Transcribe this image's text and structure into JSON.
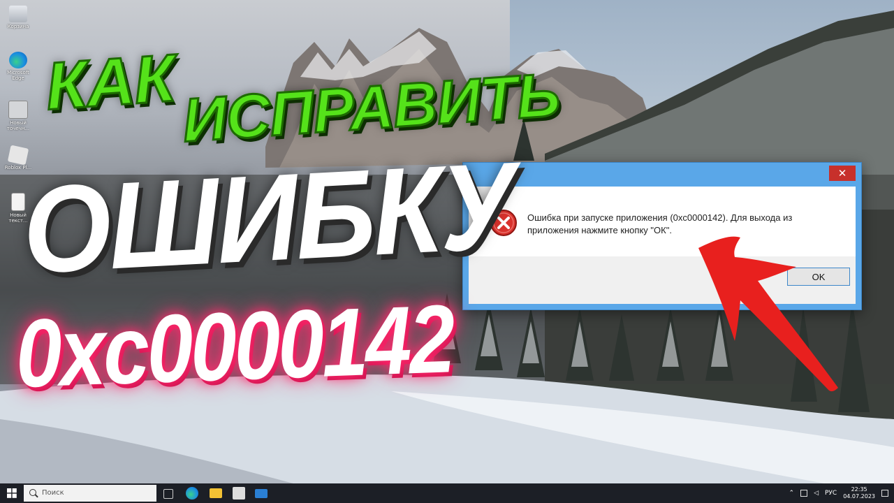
{
  "overlay": {
    "line1_a": "КАК",
    "line1_b": "ИСПРАВИТЬ",
    "line2": "ОШИБКУ",
    "line3": "0xc0000142"
  },
  "desktop_icons": [
    {
      "label": "Корзина",
      "icon": "recycle-bin-icon"
    },
    {
      "label": "Microsoft Edge",
      "icon": "edge-icon"
    },
    {
      "label": "Новый точечн...",
      "icon": "image-file-icon"
    },
    {
      "label": "Roblox Pl...",
      "icon": "roblox-icon"
    },
    {
      "label": "Новый текст...",
      "icon": "text-file-icon"
    }
  ],
  "dialog": {
    "close_label": "✕",
    "message": "Ошибка при запуске приложения (0xc0000142). Для выхода из приложения нажмите кнопку \"ОК\".",
    "ok_label": "OK",
    "accent": "#5aa7e8",
    "close_color": "#c7302b"
  },
  "taskbar": {
    "search_placeholder": "Поиск",
    "language": "РУС",
    "time": "22:35",
    "date": "04.07.2023",
    "apps": [
      "task-view-icon",
      "edge-icon",
      "file-explorer-icon",
      "store-icon",
      "mail-icon"
    ]
  }
}
